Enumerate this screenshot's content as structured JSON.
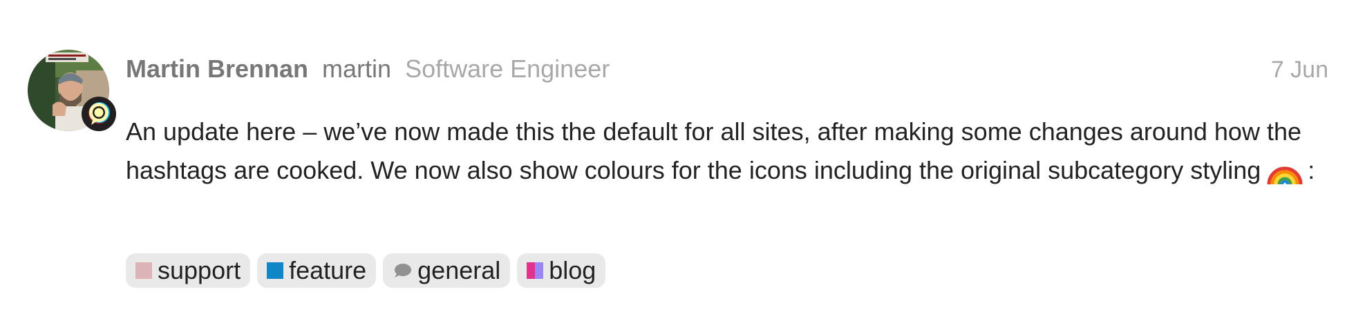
{
  "post": {
    "author": {
      "full_name": "Martin Brennan",
      "username": "martin",
      "title": "Software Engineer"
    },
    "date": "7 Jun",
    "body": "An update here – we’ve now made this the default for all sites, after making some changes around how the hashtags are cooked. We now also show colours for the icons including the original subcategory styling",
    "body_suffix": ":",
    "emoji": "rainbow",
    "hashtags": [
      {
        "label": "support",
        "icon": "square",
        "color": "#dcb3b7"
      },
      {
        "label": "feature",
        "icon": "square",
        "color": "#0e86c8"
      },
      {
        "label": "general",
        "icon": "comment-icon",
        "color": "#919191"
      },
      {
        "label": "blog",
        "icon": "split-square",
        "colors": [
          "#e1338c",
          "#9b86f3"
        ]
      }
    ]
  }
}
